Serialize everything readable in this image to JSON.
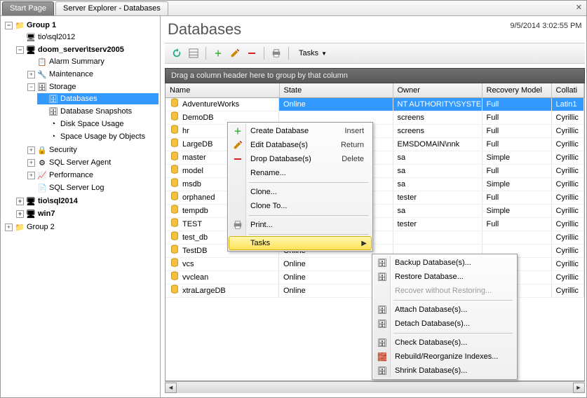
{
  "tabs": [
    {
      "label": "Start Page",
      "active": true
    },
    {
      "label": "Server Explorer - Databases",
      "active": false
    }
  ],
  "timestamp": "9/5/2014 3:02:55 PM",
  "page_title": "Databases",
  "toolbar": {
    "refresh": "Refresh",
    "print": "Print",
    "create": "Create",
    "edit": "Edit",
    "delete": "Delete",
    "print2": "Print",
    "tasks_label": "Tasks"
  },
  "group_bar": "Drag a column header here to group by that column",
  "columns": {
    "name": "Name",
    "state": "State",
    "owner": "Owner",
    "recovery": "Recovery Model",
    "collation": "Collati"
  },
  "rows": [
    {
      "name": "AdventureWorks",
      "state": "Online",
      "owner": "NT AUTHORITY\\SYSTEM",
      "recovery": "Full",
      "collation": "Latin1",
      "selected": true
    },
    {
      "name": "DemoDB",
      "state": "",
      "owner": "screens",
      "recovery": "Full",
      "collation": "Cyrillic"
    },
    {
      "name": "hr",
      "state": "",
      "owner": "screens",
      "recovery": "Full",
      "collation": "Cyrillic"
    },
    {
      "name": "LargeDB",
      "state": "",
      "owner": "EMSDOMAIN\\nnk",
      "recovery": "Full",
      "collation": "Cyrillic"
    },
    {
      "name": "master",
      "state": "",
      "owner": "sa",
      "recovery": "Simple",
      "collation": "Cyrillic"
    },
    {
      "name": "model",
      "state": "",
      "owner": "sa",
      "recovery": "Full",
      "collation": "Cyrillic"
    },
    {
      "name": "msdb",
      "state": "",
      "owner": "sa",
      "recovery": "Simple",
      "collation": "Cyrillic"
    },
    {
      "name": "orphaned",
      "state": "",
      "owner": "tester",
      "recovery": "Full",
      "collation": "Cyrillic"
    },
    {
      "name": "tempdb",
      "state": "",
      "owner": "sa",
      "recovery": "Simple",
      "collation": "Cyrillic"
    },
    {
      "name": "TEST",
      "state": "",
      "owner": "tester",
      "recovery": "Full",
      "collation": "Cyrillic"
    },
    {
      "name": "test_db",
      "state": "",
      "owner": "",
      "recovery": "",
      "collation": "Cyrillic"
    },
    {
      "name": "TestDB",
      "state": "Online",
      "owner": "",
      "recovery": "",
      "collation": "Cyrillic"
    },
    {
      "name": "vcs",
      "state": "Online",
      "owner": "",
      "recovery": "",
      "collation": "Cyrillic"
    },
    {
      "name": "vvclean",
      "state": "Online",
      "owner": "",
      "recovery": "",
      "collation": "Cyrillic"
    },
    {
      "name": "xtraLargeDB",
      "state": "Online",
      "owner": "",
      "recovery": "",
      "collation": "Cyrillic"
    }
  ],
  "tree": {
    "group1": "Group 1",
    "s1": "tio\\sql2012",
    "s2": "doom_server\\tserv2005",
    "s2_children": {
      "alarm": "Alarm Summary",
      "maint": "Maintenance",
      "storage": "Storage",
      "storage_children": {
        "databases": "Databases",
        "snapshots": "Database Snapshots",
        "disk": "Disk Space Usage",
        "objspace": "Space Usage by Objects"
      },
      "security": "Security",
      "agent": "SQL Server Agent",
      "perf": "Performance",
      "log": "SQL Server Log"
    },
    "s3": "tio\\sql2014",
    "s4": "win7",
    "group2": "Group 2"
  },
  "ctx_main": {
    "create": {
      "label": "Create Database",
      "shortcut": "Insert"
    },
    "edit": {
      "label": "Edit Database(s)",
      "shortcut": "Return"
    },
    "drop": {
      "label": "Drop Database(s)",
      "shortcut": "Delete"
    },
    "rename": {
      "label": "Rename..."
    },
    "clone": {
      "label": "Clone..."
    },
    "cloneto": {
      "label": "Clone To..."
    },
    "print": {
      "label": "Print..."
    },
    "tasks": {
      "label": "Tasks"
    }
  },
  "ctx_tasks": {
    "backup": "Backup Database(s)...",
    "restore": "Restore Database...",
    "recover": "Recover without Restoring...",
    "attach": "Attach Database(s)...",
    "detach": "Detach Database(s)...",
    "check": "Check Database(s)...",
    "rebuild": "Rebuild/Reorganize Indexes...",
    "shrink": "Shrink Database(s)..."
  }
}
